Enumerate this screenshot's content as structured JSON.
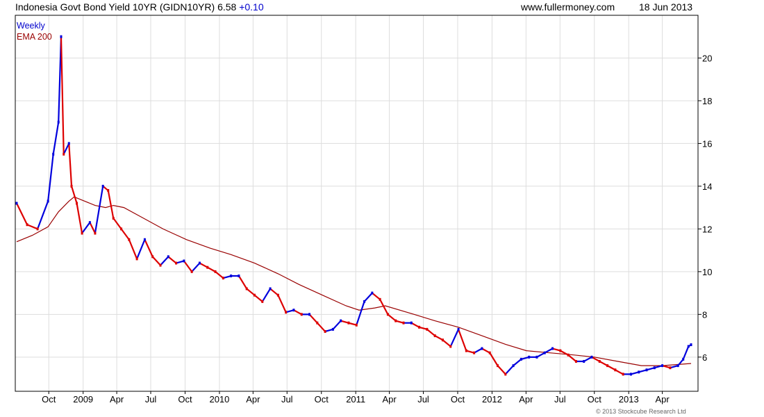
{
  "header": {
    "title": "Indonesia Govt Bond Yield 10YR",
    "symbol": "(GIDN10YR)",
    "last": "6.58",
    "change": "+0.10",
    "site": "www.fullermoney.com",
    "date": "18 Jun 2013"
  },
  "legend": {
    "interval": "Weekly",
    "ema": "EMA 200"
  },
  "copyright": "© 2013 Stockcube Research Ltd",
  "colors": {
    "up": "#0000dd",
    "down": "#dd0000",
    "ema": "#990000",
    "grid": "#dddddd",
    "frame": "#000000"
  },
  "chart_data": {
    "type": "line",
    "subtype": "weekly-ohlc-bars-with-ema",
    "title": "Indonesia Govt Bond Yield 10YR (GIDN10YR) 6.58 +0.10",
    "xlabel": "",
    "ylabel": "",
    "ylim": [
      4.4,
      22.0
    ],
    "y_ticks": [
      6,
      8,
      10,
      12,
      14,
      16,
      18,
      20
    ],
    "x_tick_labels": [
      "Oct",
      "2009",
      "Apr",
      "Jul",
      "Oct",
      "2010",
      "Apr",
      "Jul",
      "Oct",
      "2011",
      "Apr",
      "Jul",
      "Oct",
      "2012",
      "Apr",
      "Jul",
      "Oct",
      "2013",
      "Apr"
    ],
    "x_range": [
      "2008-07-07",
      "2013-06-17"
    ],
    "x_ticks": [
      "2008-10-01",
      "2009-01-01",
      "2009-04-01",
      "2009-07-01",
      "2009-10-01",
      "2010-01-01",
      "2010-04-01",
      "2010-07-01",
      "2010-10-01",
      "2011-01-01",
      "2011-04-01",
      "2011-07-01",
      "2011-10-01",
      "2012-01-01",
      "2012-04-01",
      "2012-07-01",
      "2012-10-01",
      "2013-01-01",
      "2013-04-01"
    ],
    "grid": true,
    "series": [
      {
        "name": "Weekly",
        "points": [
          [
            "2008-07-07",
            13.2
          ],
          [
            "2008-08-04",
            12.2
          ],
          [
            "2008-09-01",
            12.0
          ],
          [
            "2008-09-29",
            13.3
          ],
          [
            "2008-10-13",
            15.5
          ],
          [
            "2008-10-27",
            17.0
          ],
          [
            "2008-11-03",
            21.0
          ],
          [
            "2008-11-10",
            15.5
          ],
          [
            "2008-11-24",
            16.0
          ],
          [
            "2008-12-01",
            14.0
          ],
          [
            "2008-12-15",
            13.2
          ],
          [
            "2008-12-29",
            11.8
          ],
          [
            "2009-01-19",
            12.3
          ],
          [
            "2009-02-02",
            11.8
          ],
          [
            "2009-02-23",
            14.0
          ],
          [
            "2009-03-09",
            13.8
          ],
          [
            "2009-03-23",
            12.5
          ],
          [
            "2009-04-13",
            12.0
          ],
          [
            "2009-05-04",
            11.5
          ],
          [
            "2009-05-25",
            10.6
          ],
          [
            "2009-06-15",
            11.5
          ],
          [
            "2009-07-06",
            10.7
          ],
          [
            "2009-07-27",
            10.3
          ],
          [
            "2009-08-17",
            10.7
          ],
          [
            "2009-09-07",
            10.4
          ],
          [
            "2009-09-28",
            10.5
          ],
          [
            "2009-10-19",
            10.0
          ],
          [
            "2009-11-09",
            10.4
          ],
          [
            "2009-11-30",
            10.2
          ],
          [
            "2009-12-21",
            10.0
          ],
          [
            "2010-01-11",
            9.7
          ],
          [
            "2010-02-01",
            9.8
          ],
          [
            "2010-02-22",
            9.8
          ],
          [
            "2010-03-15",
            9.2
          ],
          [
            "2010-04-05",
            8.9
          ],
          [
            "2010-04-26",
            8.6
          ],
          [
            "2010-05-17",
            9.2
          ],
          [
            "2010-06-07",
            8.9
          ],
          [
            "2010-06-28",
            8.1
          ],
          [
            "2010-07-19",
            8.2
          ],
          [
            "2010-08-09",
            8.0
          ],
          [
            "2010-08-30",
            8.0
          ],
          [
            "2010-09-20",
            7.6
          ],
          [
            "2010-10-11",
            7.2
          ],
          [
            "2010-11-01",
            7.3
          ],
          [
            "2010-11-22",
            7.7
          ],
          [
            "2010-12-13",
            7.6
          ],
          [
            "2011-01-03",
            7.5
          ],
          [
            "2011-01-24",
            8.6
          ],
          [
            "2011-02-14",
            9.0
          ],
          [
            "2011-03-07",
            8.7
          ],
          [
            "2011-03-28",
            8.0
          ],
          [
            "2011-04-18",
            7.7
          ],
          [
            "2011-05-09",
            7.6
          ],
          [
            "2011-05-30",
            7.6
          ],
          [
            "2011-06-20",
            7.4
          ],
          [
            "2011-07-11",
            7.3
          ],
          [
            "2011-08-01",
            7.0
          ],
          [
            "2011-08-22",
            6.8
          ],
          [
            "2011-09-12",
            6.5
          ],
          [
            "2011-10-03",
            7.3
          ],
          [
            "2011-10-24",
            6.3
          ],
          [
            "2011-11-14",
            6.2
          ],
          [
            "2011-12-05",
            6.4
          ],
          [
            "2011-12-26",
            6.2
          ],
          [
            "2012-01-16",
            5.6
          ],
          [
            "2012-02-06",
            5.2
          ],
          [
            "2012-02-27",
            5.6
          ],
          [
            "2012-03-19",
            5.9
          ],
          [
            "2012-04-09",
            6.0
          ],
          [
            "2012-04-30",
            6.0
          ],
          [
            "2012-05-21",
            6.2
          ],
          [
            "2012-06-11",
            6.4
          ],
          [
            "2012-07-02",
            6.3
          ],
          [
            "2012-07-23",
            6.1
          ],
          [
            "2012-08-13",
            5.8
          ],
          [
            "2012-09-03",
            5.8
          ],
          [
            "2012-09-24",
            6.0
          ],
          [
            "2012-10-15",
            5.8
          ],
          [
            "2012-11-05",
            5.6
          ],
          [
            "2012-11-26",
            5.4
          ],
          [
            "2012-12-17",
            5.2
          ],
          [
            "2013-01-07",
            5.2
          ],
          [
            "2013-01-28",
            5.3
          ],
          [
            "2013-02-18",
            5.4
          ],
          [
            "2013-03-11",
            5.5
          ],
          [
            "2013-04-01",
            5.6
          ],
          [
            "2013-04-22",
            5.5
          ],
          [
            "2013-05-13",
            5.6
          ],
          [
            "2013-05-27",
            5.9
          ],
          [
            "2013-06-10",
            6.5
          ],
          [
            "2013-06-17",
            6.58
          ]
        ]
      },
      {
        "name": "EMA 200",
        "points": [
          [
            "2008-07-07",
            11.4
          ],
          [
            "2008-08-18",
            11.7
          ],
          [
            "2008-09-29",
            12.1
          ],
          [
            "2008-10-27",
            12.8
          ],
          [
            "2008-11-24",
            13.3
          ],
          [
            "2008-12-08",
            13.5
          ],
          [
            "2009-01-05",
            13.3
          ],
          [
            "2009-02-02",
            13.1
          ],
          [
            "2009-03-02",
            13.0
          ],
          [
            "2009-03-23",
            13.1
          ],
          [
            "2009-04-20",
            13.0
          ],
          [
            "2009-06-01",
            12.6
          ],
          [
            "2009-08-03",
            12.0
          ],
          [
            "2009-10-05",
            11.5
          ],
          [
            "2009-12-07",
            11.1
          ],
          [
            "2010-02-01",
            10.8
          ],
          [
            "2010-04-05",
            10.4
          ],
          [
            "2010-06-07",
            9.9
          ],
          [
            "2010-08-02",
            9.4
          ],
          [
            "2010-10-04",
            8.9
          ],
          [
            "2010-12-06",
            8.4
          ],
          [
            "2011-01-10",
            8.2
          ],
          [
            "2011-02-21",
            8.3
          ],
          [
            "2011-03-21",
            8.4
          ],
          [
            "2011-06-06",
            8.0
          ],
          [
            "2011-08-01",
            7.7
          ],
          [
            "2011-10-03",
            7.4
          ],
          [
            "2011-12-05",
            7.0
          ],
          [
            "2012-02-06",
            6.6
          ],
          [
            "2012-04-02",
            6.3
          ],
          [
            "2012-06-04",
            6.2
          ],
          [
            "2012-08-06",
            6.1
          ],
          [
            "2012-10-01",
            6.0
          ],
          [
            "2012-12-03",
            5.8
          ],
          [
            "2013-02-04",
            5.6
          ],
          [
            "2013-04-01",
            5.6
          ],
          [
            "2013-06-17",
            5.7
          ]
        ]
      }
    ]
  }
}
